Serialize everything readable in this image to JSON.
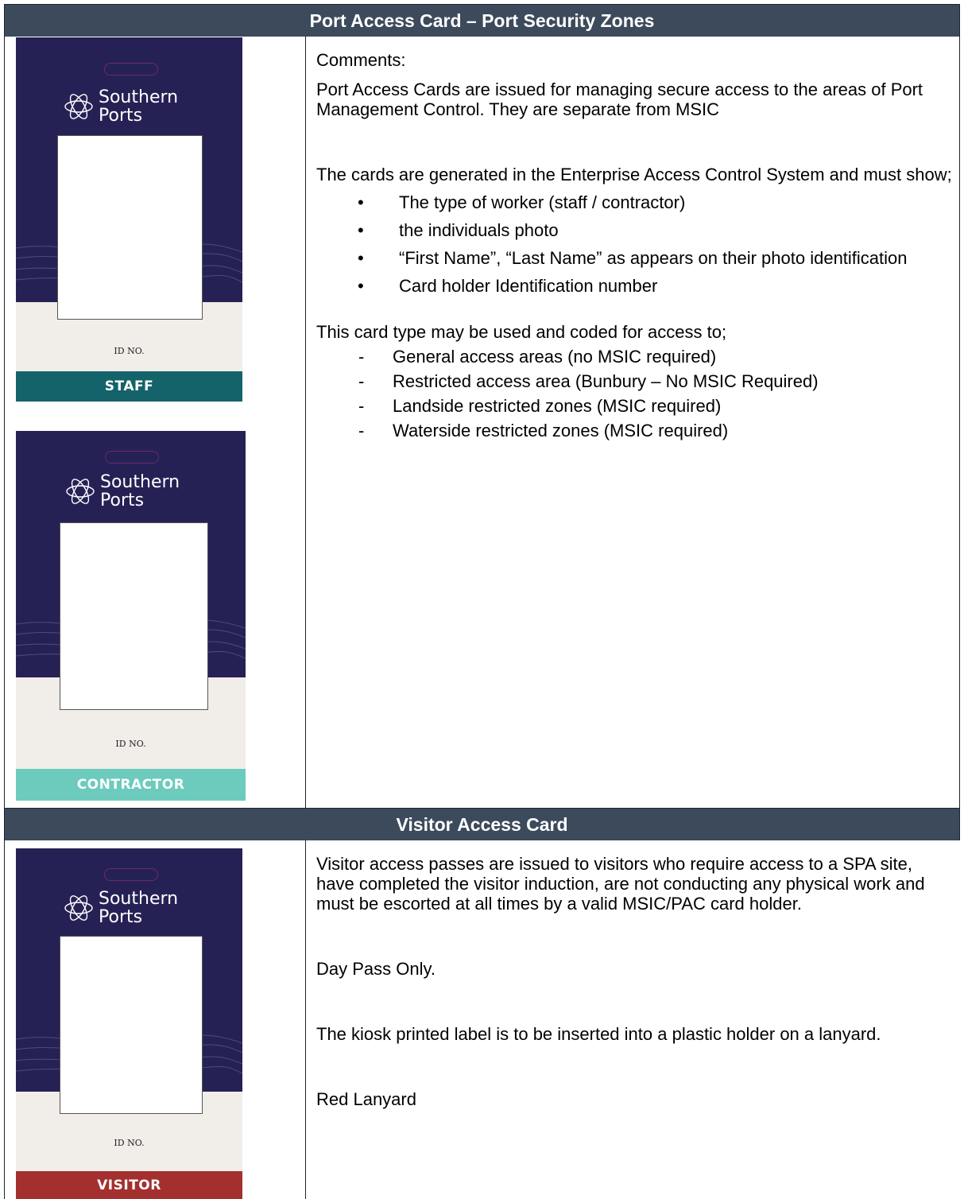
{
  "section1": {
    "title": "Port Access Card – Port Security Zones",
    "comments_label": "Comments:",
    "para1": "Port Access Cards are issued for managing secure access to the areas of Port Management Control. They are separate from MSIC",
    "para2": "The cards are generated in the Enterprise Access Control System and must show;",
    "bullets": [
      "The type of worker (staff / contractor)",
      "the individuals photo",
      "“First Name”, “Last Name” as appears on their photo identification",
      "Card holder Identification number"
    ],
    "para3": "This card type may be used and coded for access to;",
    "dashes": [
      "General access areas (no MSIC required)",
      "Restricted access area (Bunbury – No MSIC Required)",
      "Landside restricted zones (MSIC required)",
      "Waterside restricted zones (MSIC required)"
    ]
  },
  "section2": {
    "title": "Visitor Access Card",
    "para1": "Visitor access passes are issued to visitors who require access to a SPA site, have completed the visitor induction, are not conducting any physical work and must be escorted at all times by a valid MSIC/PAC card holder.",
    "para2": "Day Pass Only.",
    "para3": "The kiosk printed label is to be inserted into a plastic holder on a lanyard.",
    "para4": "Red Lanyard"
  },
  "cards": {
    "logo_line1": "Southern",
    "logo_line2": "Ports",
    "id_label": "ID NO.",
    "staff_label": "STAFF",
    "contractor_label": "CONTRACTOR",
    "visitor_label": "VISITOR",
    "colors": {
      "navy": "#262155",
      "cream": "#f1ede8",
      "staff": "#14636a",
      "contractor": "#6ccbbd",
      "visitor": "#a3302f"
    },
    "logo_icon": "atom-icon"
  },
  "bullet_marker": "•",
  "dash_marker": "-"
}
